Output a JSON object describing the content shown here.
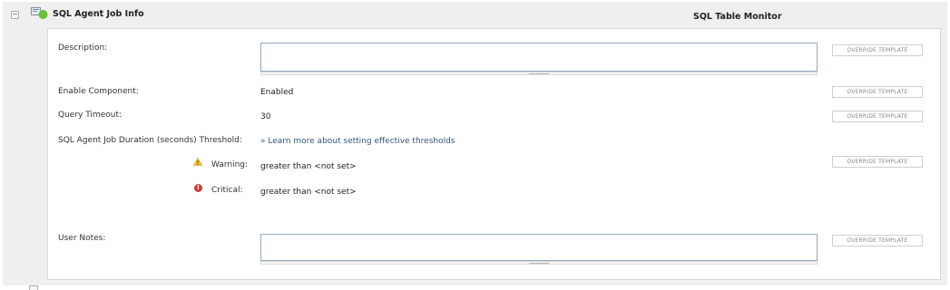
{
  "header": {
    "title": "SQL Agent Job Info",
    "right_label": "SQL Table Monitor",
    "toggle_glyph": "−",
    "icon": "component-status-icon",
    "status_color": "#6cbf3a"
  },
  "fields": {
    "description": {
      "label": "Description:",
      "value": "",
      "button": "OVERRIDE TEMPLATE"
    },
    "enable_component": {
      "label": "Enable Component:",
      "value": "Enabled",
      "button": "OVERRIDE TEMPLATE"
    },
    "query_timeout": {
      "label": "Query Timeout:",
      "value": "30",
      "button": "OVERRIDE TEMPLATE"
    },
    "threshold": {
      "label": "SQL Agent Job Duration (seconds) Threshold:",
      "link": "» Learn more about setting effective thresholds",
      "warning_label": "Warning:",
      "warning_value": "greater than <not set>",
      "critical_label": "Critical:",
      "critical_value": "greater than <not set>",
      "button": "OVERRIDE TEMPLATE",
      "warning_color": "#f2c12e",
      "critical_color": "#d23a3a"
    },
    "user_notes": {
      "label": "User Notes:",
      "value": "",
      "button": "OVERRIDE TEMPLATE"
    }
  }
}
